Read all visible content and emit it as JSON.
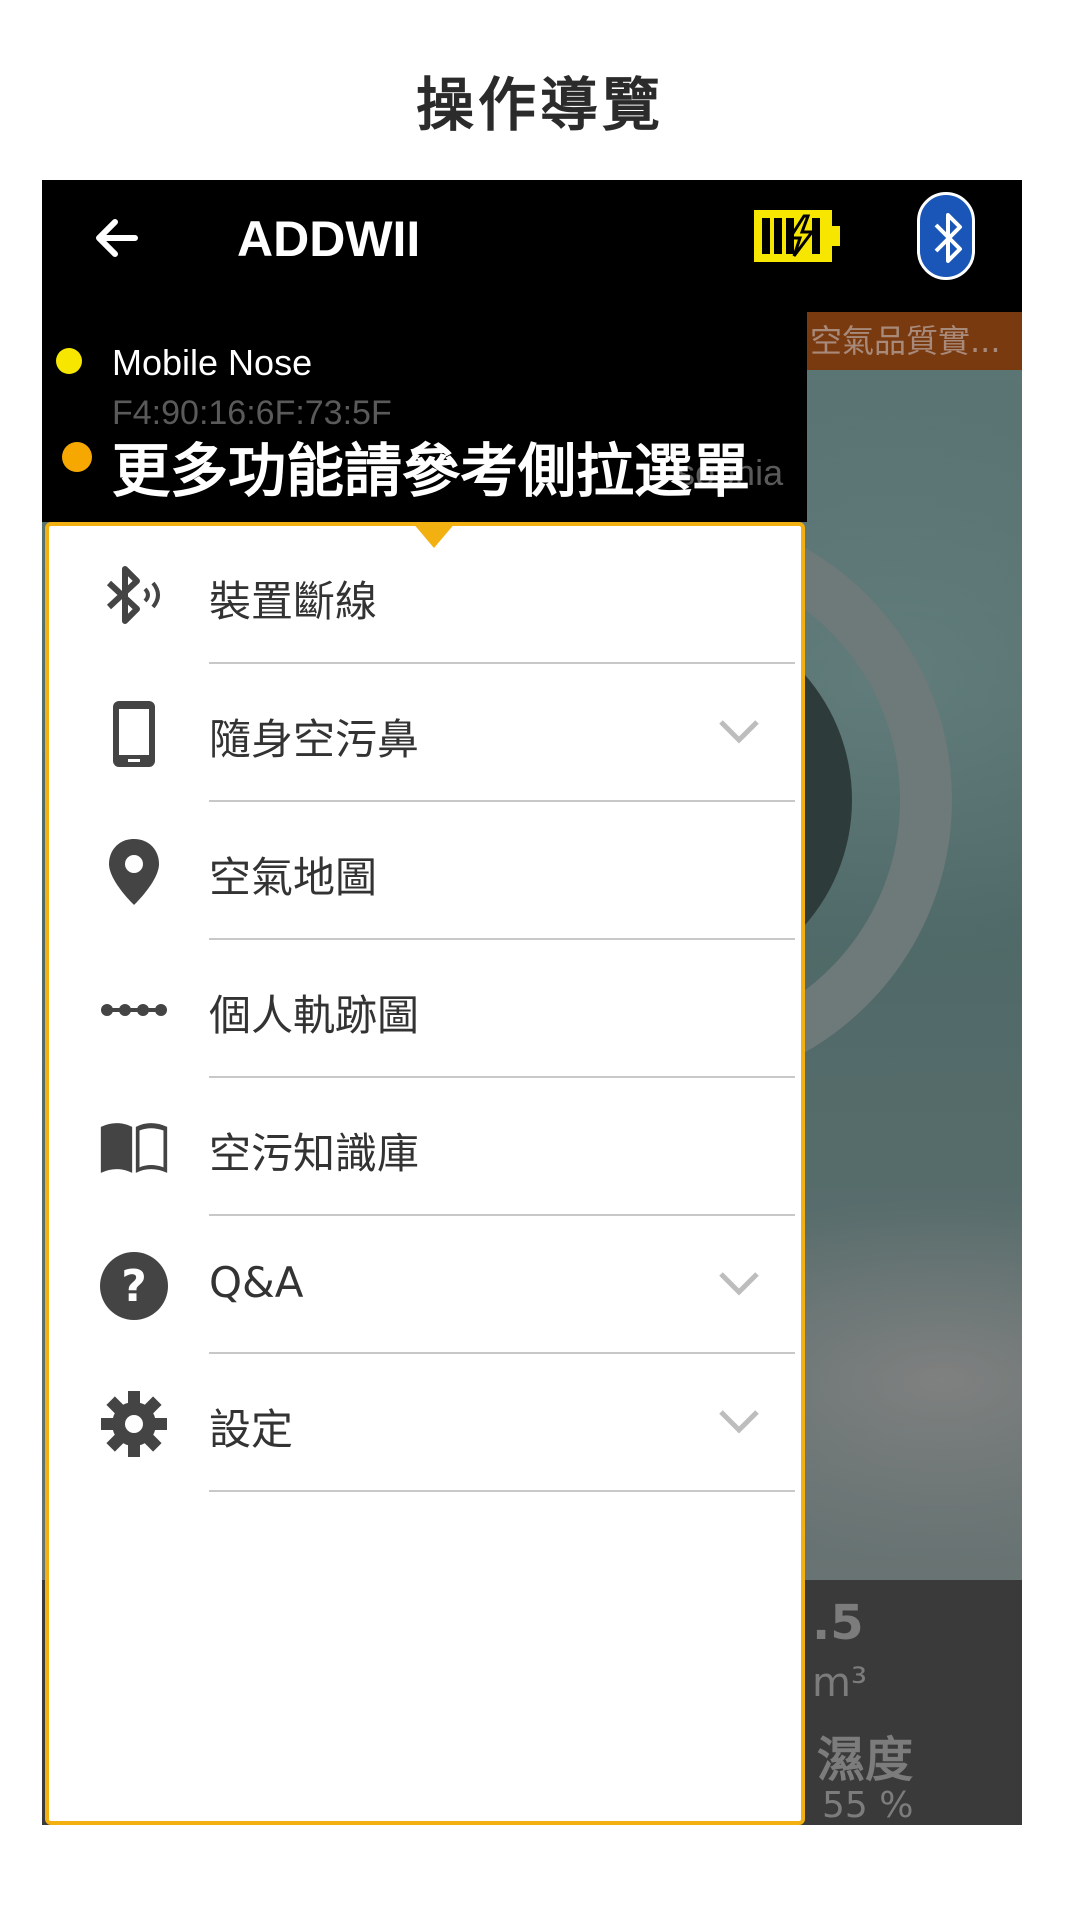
{
  "page_title": "操作導覽",
  "app_bar": {
    "title": "ADDWII",
    "back_icon": "arrow-left-icon",
    "battery_icon": "battery-charging-icon",
    "bluetooth_icon": "bluetooth-icon",
    "colors": {
      "bar": "#000000",
      "battery": "#f7e600",
      "bluetooth": "#1a55b8"
    }
  },
  "background": {
    "banner_text": "空氣品質實...",
    "value_text": ".5",
    "unit_text": "m³",
    "humidity_label": "濕度",
    "humidity_value": "55 %"
  },
  "drawer_header": {
    "device_name": "Mobile Nose",
    "device_mac": "F4:90:16:6F:73:5F",
    "user_name": "sophia",
    "hint": "更多功能請參考側拉選單",
    "colors": {
      "status_dot": "#f7e600",
      "hint_dot": "#f7a800",
      "highlight_border": "#f2b011"
    }
  },
  "menu": {
    "items": [
      {
        "label": "裝置斷線",
        "icon": "bluetooth-disconnect-icon",
        "expandable": false
      },
      {
        "label": "隨身空污鼻",
        "icon": "mobile-device-icon",
        "expandable": true
      },
      {
        "label": "空氣地圖",
        "icon": "map-pin-icon",
        "expandable": false
      },
      {
        "label": "個人軌跡圖",
        "icon": "track-dots-icon",
        "expandable": false
      },
      {
        "label": "空污知識庫",
        "icon": "book-icon",
        "expandable": false
      },
      {
        "label": "Q&A",
        "icon": "question-circle-icon",
        "expandable": true
      },
      {
        "label": "設定",
        "icon": "gear-icon",
        "expandable": true
      }
    ]
  }
}
